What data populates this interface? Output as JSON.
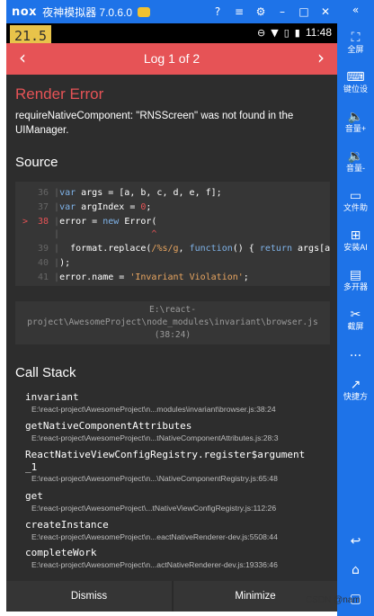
{
  "emulator": {
    "brand": "nox",
    "title": "夜神模拟器 7.0.6.0"
  },
  "sidebar": {
    "collapse": "«",
    "items": [
      {
        "icon": "expand-icon",
        "glyph": "⛶",
        "label": "全屏"
      },
      {
        "icon": "keyboard-icon",
        "glyph": "⌨",
        "label": "键位设"
      },
      {
        "icon": "volume-up-icon",
        "glyph": "🔈",
        "label": "音量+"
      },
      {
        "icon": "volume-down-icon",
        "glyph": "🔉",
        "label": "音量-"
      },
      {
        "icon": "folder-icon",
        "glyph": "▭",
        "label": "文件助"
      },
      {
        "icon": "install-apk-icon",
        "glyph": "⊞",
        "label": "安装AI"
      },
      {
        "icon": "multi-instance-icon",
        "glyph": "▤",
        "label": "多开器"
      },
      {
        "icon": "scissors-icon",
        "glyph": "✂",
        "label": "截屏"
      },
      {
        "icon": "more-icon",
        "glyph": "···",
        "label": ""
      },
      {
        "icon": "shortcut-icon",
        "glyph": "↗",
        "label": "快捷方"
      },
      {
        "icon": "back-icon",
        "glyph": "↩",
        "label": ""
      },
      {
        "icon": "home-icon",
        "glyph": "⌂",
        "label": ""
      },
      {
        "icon": "recent-apps-icon",
        "glyph": "▢",
        "label": ""
      }
    ]
  },
  "statusbar": {
    "counter": "21.5",
    "time": "11:48"
  },
  "log": {
    "prev": "‹",
    "next": "›",
    "title": "Log 1 of 2"
  },
  "error": {
    "title": "Render Error",
    "message": "requireNativeComponent: \"RNSScreen\" was not found in the UIManager."
  },
  "source": {
    "heading": "Source",
    "lines": [
      {
        "num": "36",
        "code": "var args = [a, b, c, d, e, f];"
      },
      {
        "num": "37",
        "code": "var argIndex = 0;"
      },
      {
        "num": "38",
        "code": "error = new Error("
      },
      {
        "num": "39",
        "code": "  format.replace(/%s/g, function() { return args[arg"
      },
      {
        "num": "40",
        "code": ");"
      },
      {
        "num": "41",
        "code": "error.name = 'Invariant Violation';"
      }
    ],
    "marker": ">",
    "caret": "^",
    "file": "E:\\react-project\\AwesomeProject\\node_modules\\invariant\\browser.js (38:24)",
    "file_lines": [
      "E:\\react-",
      "project\\AwesomeProject\\node_modules\\invariant\\browser.js",
      "(38:24)"
    ]
  },
  "call_stack": {
    "heading": "Call Stack",
    "frames": [
      {
        "fn": "invariant",
        "path": "E:\\react-project\\AwesomeProject\\n...modules\\invariant\\browser.js:38:24"
      },
      {
        "fn": "getNativeComponentAttributes",
        "path": "E:\\react-project\\AwesomeProject\\n...tNativeComponentAttributes.js:28:3"
      },
      {
        "fn": "ReactNativeViewConfigRegistry.register$argument",
        "fn_cont": "_1",
        "path": "E:\\react-project\\AwesomeProject\\n...\\NativeComponentRegistry.js:65:48"
      },
      {
        "fn": "get",
        "path": "E:\\react-project\\AwesomeProject\\...tNativeViewConfigRegistry.js:112:26"
      },
      {
        "fn": "createInstance",
        "path": "E:\\react-project\\AwesomeProject\\n...eactNativeRenderer-dev.js:5508:44"
      },
      {
        "fn": "completeWork",
        "path": "E:\\react-project\\AwesomeProject\\n...actNativeRenderer-dev.js:19336:46"
      }
    ]
  },
  "footer": {
    "dismiss": "Dismiss",
    "minimize": "Minimize"
  },
  "watermark": "CSDN @nam",
  "colors": {
    "emulator_blue": "#1e73e8",
    "error_red": "#e65356",
    "background": "#2d2d2d",
    "counter_yellow": "#e8c34a"
  }
}
